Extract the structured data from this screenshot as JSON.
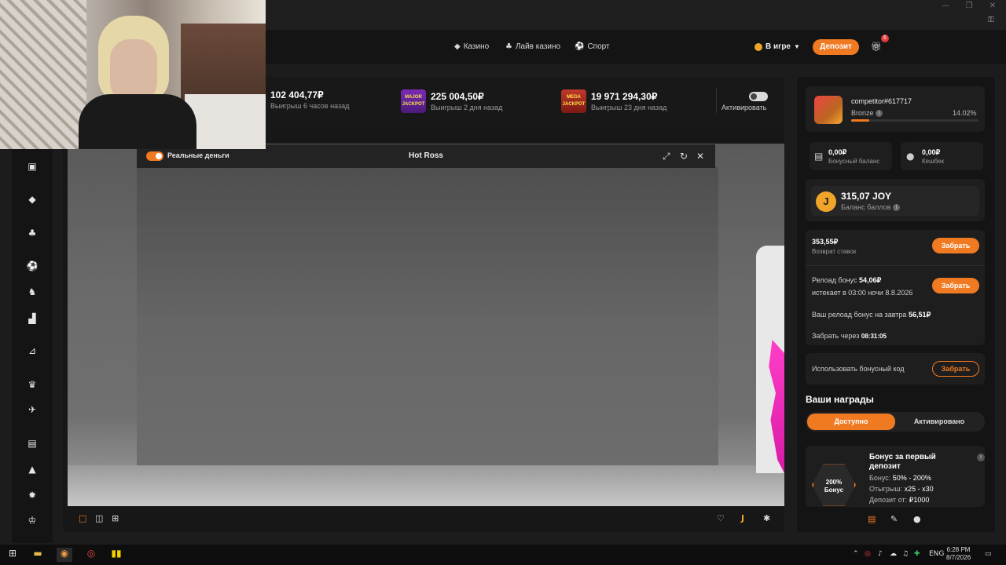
{
  "window": {
    "minimize": "—",
    "restore": "❐",
    "close": "✕",
    "extra_icon": "key-icon"
  },
  "topnav": {
    "links": [
      {
        "label": "Казино",
        "icon": "casino-icon"
      },
      {
        "label": "Лайв казино",
        "icon": "live-casino-icon"
      },
      {
        "label": "Спорт",
        "icon": "sport-icon"
      }
    ],
    "in_game": "В игре",
    "deposit": "Депозит",
    "gift_badge": "6"
  },
  "wins": [
    {
      "amount": "102 404,77₽",
      "sub": "Выигрыш 6 часов назад"
    },
    {
      "amount": "225 004,50₽",
      "sub": "Выигрыш 2 дня назад",
      "badge": "MAJOR JACKPOT"
    },
    {
      "amount": "19 971 294,30₽",
      "sub": "Выигрыш 23 дня назад",
      "badge": "MEGA JACKPOT"
    }
  ],
  "activate_label": "Активировать",
  "game": {
    "real_money": "Реальные деньги",
    "title": "Hot Ross"
  },
  "user": {
    "name": "competitor#617717",
    "rank": "Bronze",
    "rank_pct": "14.02%",
    "rank_progress": 0.1402
  },
  "balances": [
    {
      "value": "0,00₽",
      "label": "Бонусный баланс",
      "icon": "gift-icon"
    },
    {
      "value": "0,00₽",
      "label": "Кешбек",
      "icon": "piggy-bank-icon"
    }
  ],
  "joy": {
    "value": "315,07 JOY",
    "label": "Баланс баллов",
    "icon_text": "J"
  },
  "cashback": {
    "value": "353,55₽",
    "label": "Возврат ставок",
    "button": "Забрать"
  },
  "reload": {
    "label": "Релоад бонус",
    "value": "54,06₽",
    "expires": "истекает в 03:00 ночи 8.8.2026",
    "button": "Забрать",
    "tomorrow_label": "Ваш релоад бонус на завтра",
    "tomorrow_value": "56,51₽",
    "claim_in_label": "Забрать через",
    "claim_in_value": "08:31:05"
  },
  "promo": {
    "label": "Использовать бонусный код",
    "button": "Забрать"
  },
  "rewards": {
    "title": "Ваши награды",
    "tab_available": "Доступно",
    "tab_activated": "Активировано",
    "bonus_badge_line1": "200%",
    "bonus_badge_line2": "Бонус",
    "bonus_title": "Бонус за первый депозит",
    "bonus_label": "Бонус:",
    "bonus_value": "50% - 200%",
    "wager_label": "Отыгрыш:",
    "wager_value": "x25 - x30",
    "deposit_label": "Депозит от:",
    "deposit_value": "₽1000"
  },
  "taskbar": {
    "lang": "ENG",
    "time": "6:28 PM",
    "date": "8/7/2026"
  },
  "colors": {
    "accent": "#f07a22",
    "background": "#1c1c1c",
    "panel": "#141414"
  }
}
